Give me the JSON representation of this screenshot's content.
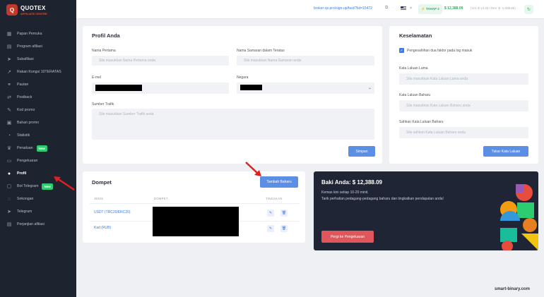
{
  "brand": {
    "title": "QUOTEX",
    "subtitle": "AFFILIATE CENTRE",
    "mark": "Q"
  },
  "sidebar": {
    "items": [
      {
        "label": "Papan Pemuka",
        "icon": "dashboard-icon",
        "glyph": "▦"
      },
      {
        "label": "Program afiliasi",
        "icon": "program-icon",
        "glyph": "▤"
      },
      {
        "label": "Subafiliasi",
        "icon": "send-icon",
        "glyph": "➤"
      },
      {
        "label": "Rakan Kongsi 10TERATAS",
        "icon": "trend-icon",
        "glyph": "↗"
      },
      {
        "label": "Pautan",
        "icon": "link-icon",
        "glyph": "⚭"
      },
      {
        "label": "Postback",
        "icon": "postback-icon",
        "glyph": "⇄"
      },
      {
        "label": "Kod promo",
        "icon": "tag-icon",
        "glyph": "✎"
      },
      {
        "label": "Bahan promo",
        "icon": "promo-material-icon",
        "glyph": "▣"
      },
      {
        "label": "Statistik",
        "icon": "chart-icon",
        "glyph": "◔"
      },
      {
        "label": "Peraduan",
        "icon": "trophy-icon",
        "glyph": "♛",
        "badge": "New"
      },
      {
        "label": "Pengeluaran",
        "icon": "withdraw-icon",
        "glyph": "▭"
      },
      {
        "label": "Profil",
        "icon": "user-icon",
        "glyph": "●",
        "active": true
      },
      {
        "label": "Bot Telegram",
        "icon": "bot-icon",
        "glyph": "▢",
        "badge": "New"
      },
      {
        "label": "Sokongan",
        "icon": "support-icon",
        "glyph": "◌"
      },
      {
        "label": "Telegram",
        "icon": "telegram-icon",
        "glyph": "➤"
      },
      {
        "label": "Perjanjian afiliasi",
        "icon": "agreement-icon",
        "glyph": "▤"
      }
    ]
  },
  "topbar": {
    "link": "broker-qx.pro/sign-up/fast/?lid=15472",
    "tier": "⚡ TAHAP 2",
    "balance": "$ 12,388.09",
    "balance_detail": "(Vol: $ 13.33 / Rev: $ -1,008.85)"
  },
  "profile": {
    "title": "Profil Anda",
    "first_name_label": "Nama Pertama",
    "first_name_placeholder": "Sila masukkan Nama Pertama anda",
    "nickname_label": "Nama Samaran dalam Teratas",
    "nickname_placeholder": "Sila masukkan Nama Samaran anda",
    "email_label": "E-mel",
    "country_label": "Negara",
    "traffic_label": "Sumber Trafik",
    "traffic_placeholder": "Sila masukkan Sumber Trafik anda",
    "save": "Simpan"
  },
  "security": {
    "title": "Keselamatan",
    "twofa_label": "Pengesahihan dua faktor pada log masuk",
    "old_pw_label": "Kata Laluan Lama",
    "old_pw_placeholder": "Sila masukkan Kata Laluan Lama anda",
    "new_pw_label": "Kata Laluan Baharu",
    "new_pw_placeholder": "Sila masukkan Kata Laluan Baharu anda",
    "confirm_pw_label": "Sahkan Kata Laluan Baharu",
    "confirm_pw_placeholder": "Sila sahkan Kata Laluan Baharu anda",
    "submit": "Tukar Kata Laluan"
  },
  "wallet": {
    "title": "Dompet",
    "add": "Tambah Baharu",
    "columns": [
      "JENIS",
      "DOMPET",
      "TINDAKAN"
    ],
    "rows": [
      {
        "type": "USDT (TRC20/ERC20)"
      },
      {
        "type": "Kad (RUB)"
      }
    ]
  },
  "balance_card": {
    "title": "Baki Anda: $ 12,388.09",
    "line1": "Kemas kini setiap 10-20 minit.",
    "line2": "Tarik perhatian pedagang-pedagang baharu dan tingkatkan pendapatan anda!",
    "button": "Pergi ke Pengeluaran"
  },
  "watermark": "smart-binary.com",
  "colors": {
    "accent": "#5b8fe6",
    "sidebar": "#1e2330",
    "danger": "#e0565b",
    "success": "#2ecc71"
  }
}
